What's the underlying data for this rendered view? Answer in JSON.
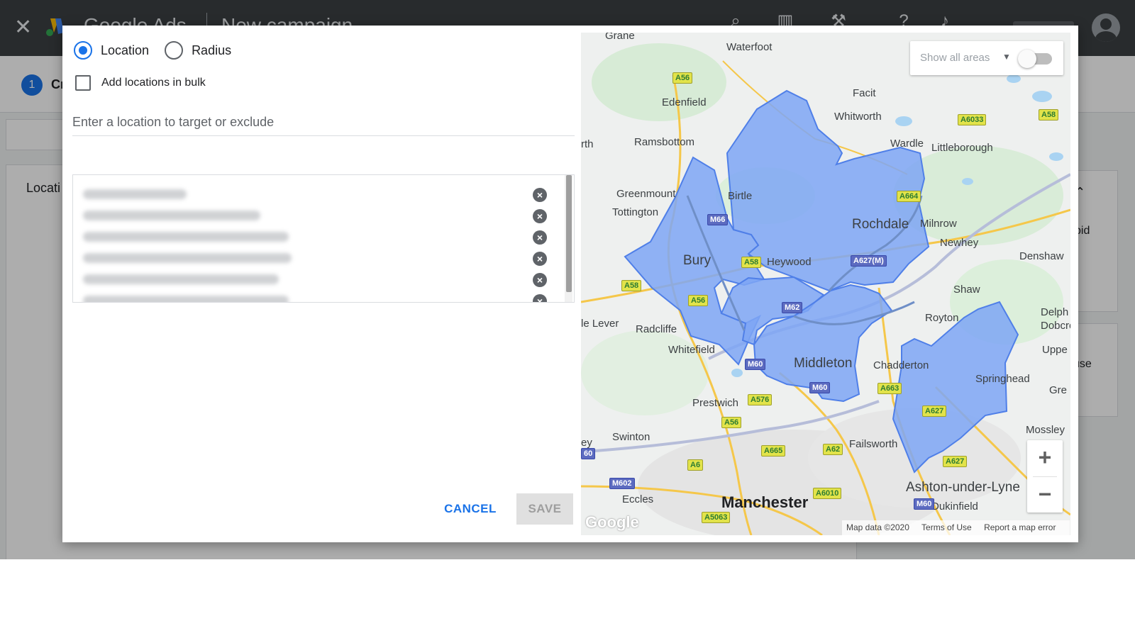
{
  "app": {
    "brand": "Google Ads",
    "page_title": "New campaign",
    "step_number": "1",
    "step_label": "Cr",
    "bg_section_label": "Locati",
    "bg_right_snippets": [
      "bid",
      "use",
      "Gre"
    ]
  },
  "dialog": {
    "radio_location_label": "Location",
    "radio_radius_label": "Radius",
    "selected_mode": "Location",
    "bulk_label": "Add locations in bulk",
    "bulk_checked": false,
    "search_placeholder": "Enter a location to target or exclude",
    "search_value": "",
    "cancel_label": "CANCEL",
    "save_label": "SAVE",
    "save_enabled": false
  },
  "map": {
    "show_all_areas_label": "Show all areas",
    "show_all_areas_on": false,
    "zoom_in_label": "+",
    "zoom_out_label": "−",
    "google_mark": "Google",
    "attribution": [
      "Map data ©2020",
      "Terms of Use",
      "Report a map error"
    ],
    "place_labels": [
      "Grane",
      "Waterfoot",
      "Edenfield",
      "Facit",
      "Whitworth",
      "Ramsbottom",
      "rth",
      "Wardle",
      "Littleborough",
      "Greenmount",
      "Birtle",
      "Tottington",
      "Rochdale",
      "Milnrow",
      "Newhey",
      "Bury",
      "Heywood",
      "Denshaw",
      "Shaw",
      "Royton",
      "Delph",
      "Dobcro",
      "le Lever",
      "Radcliffe",
      "Whitefield",
      "Uppe",
      "Middleton",
      "Chadderton",
      "Springhead",
      "Prestwich",
      "Gre",
      "Swinton",
      "Mossley",
      "ey",
      "Failsworth",
      "Eccles",
      "Manchester",
      "Ashton-under-Lyne",
      "Dukinfield"
    ],
    "road_shields": [
      "A56",
      "A6033",
      "A58",
      "A664",
      "M66",
      "A627(M)",
      "A58",
      "A58",
      "M62",
      "A56",
      "M60",
      "M60",
      "A663",
      "A576",
      "A627",
      "A56",
      "A665",
      "A62",
      "A6",
      "A627",
      "M602",
      "A6010",
      "M60",
      "60",
      "A5063"
    ],
    "colors": {
      "targeted_area_fill": "#7ea6f5",
      "targeted_area_stroke": "#4f7fe8"
    }
  }
}
